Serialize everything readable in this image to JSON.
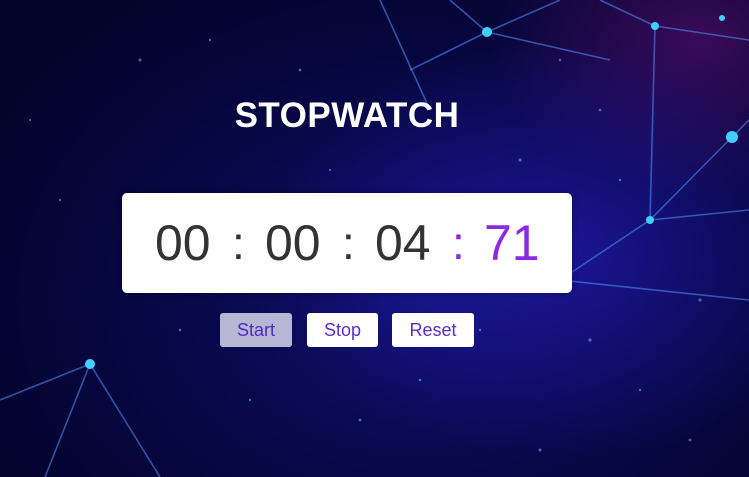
{
  "app": {
    "title": "STOPWATCH"
  },
  "timer": {
    "hours": "00",
    "minutes": "00",
    "seconds": "04",
    "centiseconds": "71",
    "separator": ":"
  },
  "controls": {
    "start_label": "Start",
    "stop_label": "Stop",
    "reset_label": "Reset",
    "active_button": "start"
  },
  "colors": {
    "accent": "#8a2be2",
    "digits": "#333333",
    "button_text": "#5a2bd0",
    "background": "#08084a"
  }
}
